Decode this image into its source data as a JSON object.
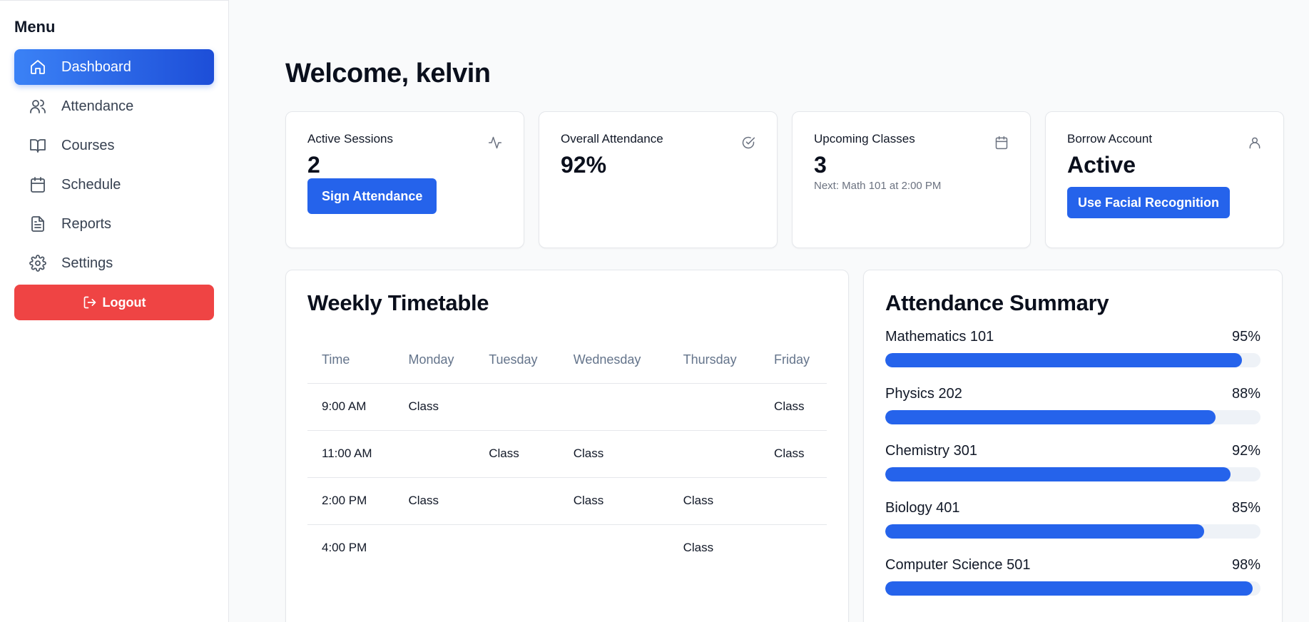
{
  "sidebar": {
    "title": "Menu",
    "items": [
      {
        "label": "Dashboard",
        "icon": "home-icon",
        "active": true
      },
      {
        "label": "Attendance",
        "icon": "users-icon",
        "active": false
      },
      {
        "label": "Courses",
        "icon": "book-icon",
        "active": false
      },
      {
        "label": "Schedule",
        "icon": "calendar-icon",
        "active": false
      },
      {
        "label": "Reports",
        "icon": "file-text-icon",
        "active": false
      },
      {
        "label": "Settings",
        "icon": "gear-icon",
        "active": false
      }
    ],
    "logout_label": "Logout"
  },
  "header": {
    "welcome": "Welcome, kelvin"
  },
  "stats": [
    {
      "title": "Active Sessions",
      "value": "2",
      "icon": "activity-icon",
      "button": "Sign Attendance"
    },
    {
      "title": "Overall Attendance",
      "value": "92%",
      "icon": "check-circle-icon"
    },
    {
      "title": "Upcoming Classes",
      "value": "3",
      "icon": "calendar-icon",
      "sub": "Next: Math 101 at 2:00 PM"
    },
    {
      "title": "Borrow Account",
      "value": "Active",
      "icon": "user-icon",
      "button": "Use Facial Recognition"
    }
  ],
  "timetable": {
    "title": "Weekly Timetable",
    "headers": [
      "Time",
      "Monday",
      "Tuesday",
      "Wednesday",
      "Thursday",
      "Friday"
    ],
    "rows": [
      [
        "9:00 AM",
        "Class",
        "",
        "",
        "",
        "Class"
      ],
      [
        "11:00 AM",
        "",
        "Class",
        "Class",
        "",
        "Class"
      ],
      [
        "2:00 PM",
        "Class",
        "",
        "Class",
        "Class",
        ""
      ],
      [
        "4:00 PM",
        "",
        "",
        "",
        "Class",
        ""
      ]
    ]
  },
  "summary": {
    "title": "Attendance Summary",
    "subjects": [
      {
        "name": "Mathematics 101",
        "percent_label": "95%",
        "value": 95
      },
      {
        "name": "Physics 202",
        "percent_label": "88%",
        "value": 88
      },
      {
        "name": "Chemistry 301",
        "percent_label": "92%",
        "value": 92
      },
      {
        "name": "Biology 401",
        "percent_label": "85%",
        "value": 85
      },
      {
        "name": "Computer Science 501",
        "percent_label": "98%",
        "value": 98
      }
    ]
  },
  "colors": {
    "primary": "#2563eb",
    "danger": "#ef4444",
    "track": "#eef2f7"
  }
}
